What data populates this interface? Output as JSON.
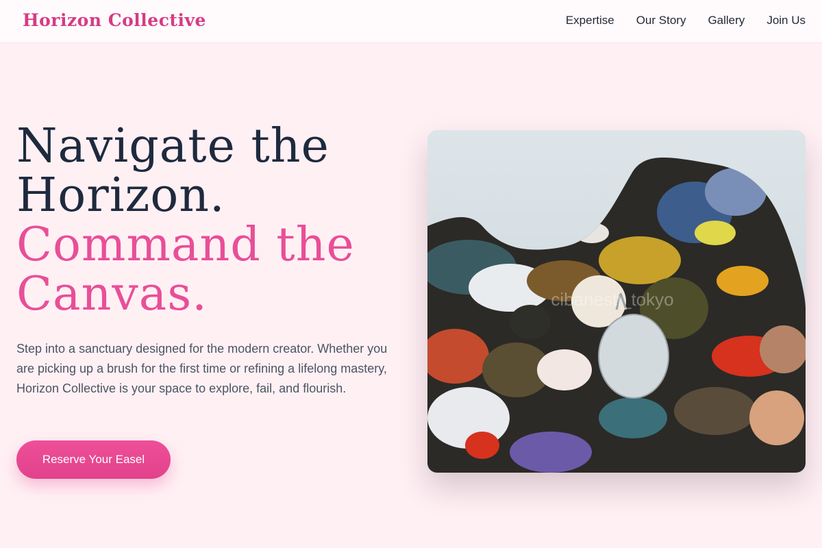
{
  "header": {
    "logo": "Horizon Collective",
    "nav": [
      "Expertise",
      "Our Story",
      "Gallery",
      "Join Us"
    ]
  },
  "hero": {
    "headline": {
      "line1": "Navigate the",
      "line2": "Horizon.",
      "line3": "Command the",
      "line4": "Canvas."
    },
    "intro": "Step into a sanctuary designed for the modern creator. Whether you are picking up a brush for the first time or refining a lifelong mastery, Horizon Collective is your space to explore, fail, and flourish.",
    "cta_label": "Reserve Your Easel",
    "image_watermark": "cibanesti_tokyo"
  },
  "colors": {
    "background": "#fff0f4",
    "brand_pink": "#e84f98",
    "heading_dark": "#1e2a3e",
    "body_text": "#4b5563"
  }
}
